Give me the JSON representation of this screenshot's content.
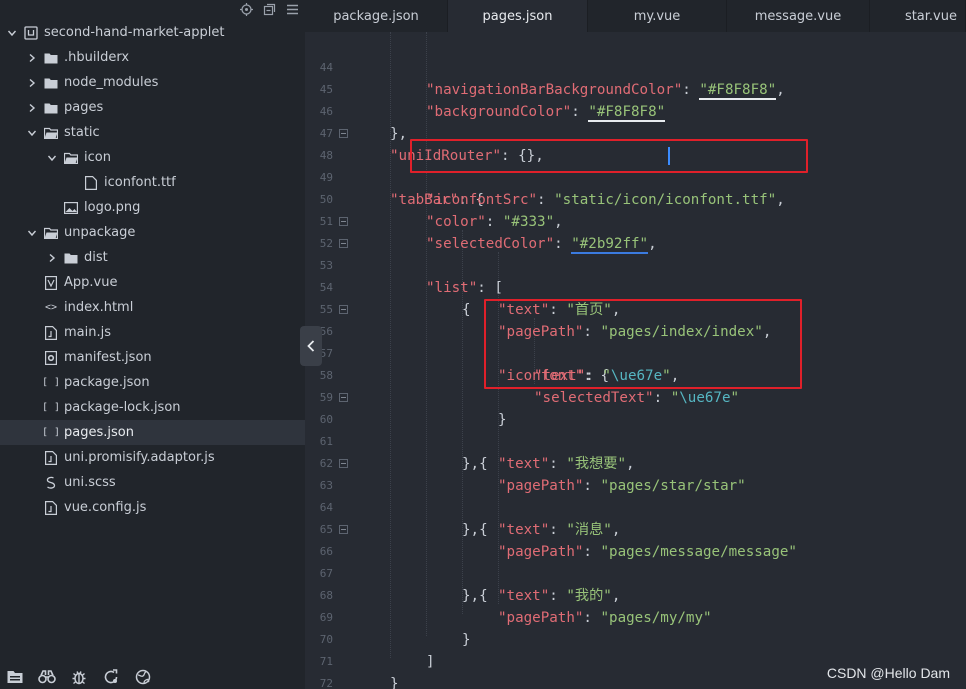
{
  "sidebar": {
    "project": "second-hand-market-applet",
    "items": [
      {
        "label": ".hbuilderx"
      },
      {
        "label": "node_modules"
      },
      {
        "label": "pages"
      },
      {
        "label": "static"
      },
      {
        "label": "icon"
      },
      {
        "label": "iconfont.ttf"
      },
      {
        "label": "logo.png"
      },
      {
        "label": "unpackage"
      },
      {
        "label": "dist"
      },
      {
        "label": "App.vue"
      },
      {
        "label": "index.html"
      },
      {
        "label": "main.js"
      },
      {
        "label": "manifest.json"
      },
      {
        "label": "package.json"
      },
      {
        "label": "package-lock.json"
      },
      {
        "label": "pages.json"
      },
      {
        "label": "uni.promisify.adaptor.js"
      },
      {
        "label": "uni.scss"
      },
      {
        "label": "vue.config.js"
      }
    ]
  },
  "tabs": [
    "package.json",
    "pages.json",
    "my.vue",
    "message.vue",
    "star.vue"
  ],
  "line_numbers": [
    "44",
    "45",
    "46",
    "47",
    "48",
    "49",
    "50",
    "51",
    "52",
    "53",
    "54",
    "55",
    "56",
    "57",
    "58",
    "59",
    "60",
    "61",
    "62",
    "63",
    "64",
    "65",
    "66",
    "67",
    "68",
    "69",
    "70",
    "71",
    "72"
  ],
  "code": {
    "l44": {
      "key": "\"navigationBarBackgroundColor\"",
      "val": "\"#F8F8F8\"",
      "sep": ": ",
      "tail": ","
    },
    "l45": {
      "key": "\"backgroundColor\"",
      "val": "\"#F8F8F8\"",
      "sep": ": "
    },
    "l46": "},",
    "l47": {
      "key": "\"uniIdRouter\"",
      "rest": ": {},"
    },
    "l48": {
      "key": "\"tabBar\"",
      "rest": ": {"
    },
    "l49": {
      "key": "\"iconfontSrc\"",
      "sep": ": ",
      "val1": "\"static/icon",
      "val2": "/iconfont.ttf\"",
      "tail": ","
    },
    "l50": {
      "key": "\"color\"",
      "sep": ": ",
      "val": "\"#333\"",
      "tail": ","
    },
    "l51": {
      "key": "\"selectedColor\"",
      "sep": ": ",
      "val": "\"#2b92ff\"",
      "tail": ","
    },
    "l52": {
      "key": "\"list\"",
      "rest": ": ["
    },
    "l53": "{",
    "l54": {
      "key": "\"text\"",
      "sep": ": ",
      "val": "\"首页\"",
      "tail": ","
    },
    "l55": {
      "key": "\"pagePath\"",
      "sep": ": ",
      "val": "\"pages/index/index\"",
      "tail": ","
    },
    "l56": {
      "key": "\"iconfont\"",
      "rest": ": {"
    },
    "l57": {
      "key": "\"text\"",
      "sep": ": ",
      "q1": "\"",
      "esc": "\\ue67e",
      "q2": "\"",
      "tail": ","
    },
    "l58": {
      "key": "\"selectedText\"",
      "sep": ": ",
      "q1": "\"",
      "esc": "\\ue67e",
      "q2": "\""
    },
    "l59": "}",
    "l60": "},{",
    "l61": {
      "key": "\"text\"",
      "sep": ": ",
      "val": "\"我想要\"",
      "tail": ","
    },
    "l62": {
      "key": "\"pagePath\"",
      "sep": ": ",
      "val": "\"pages/star/star\""
    },
    "l63": "},{",
    "l64": {
      "key": "\"text\"",
      "sep": ": ",
      "val": "\"消息\"",
      "tail": ","
    },
    "l65": {
      "key": "\"pagePath\"",
      "sep": ": ",
      "val": "\"pages/message/message\""
    },
    "l66": "},{",
    "l67": {
      "key": "\"text\"",
      "sep": ": ",
      "val": "\"我的\"",
      "tail": ","
    },
    "l68": {
      "key": "\"pagePath\"",
      "sep": ": ",
      "val": "\"pages/my/my\""
    },
    "l69": "}",
    "l70": "]",
    "l71": "}",
    "l72": "}"
  },
  "watermark": "CSDN @Hello Dam",
  "colors": {
    "key": "#e06c75",
    "string": "#98c379",
    "escape": "#56b6c2",
    "highlight_box": "#e0202a"
  }
}
